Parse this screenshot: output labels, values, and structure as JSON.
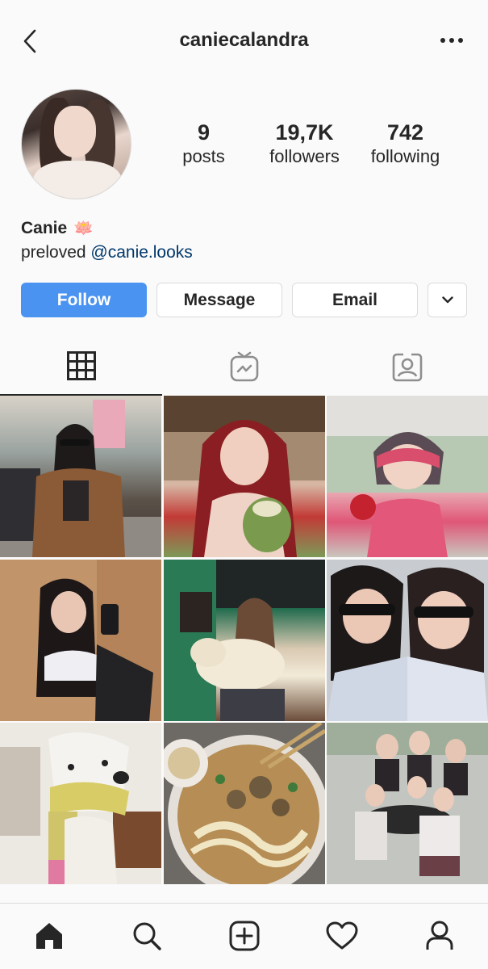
{
  "header": {
    "username": "caniecalandra",
    "back_icon": "chevron-left-icon",
    "more_icon": "more-horizontal-icon"
  },
  "profile": {
    "stats": [
      {
        "value": "9",
        "label": "posts"
      },
      {
        "value": "19,7K",
        "label": "followers"
      },
      {
        "value": "742",
        "label": "following"
      }
    ],
    "name": "Canie",
    "name_emoji": "🪷",
    "bio_text": "preloved",
    "bio_mention": "@canie.looks"
  },
  "actions": {
    "follow": "Follow",
    "message": "Message",
    "email": "Email",
    "dropdown_icon": "chevron-down-icon"
  },
  "tabs": [
    {
      "icon": "grid-icon",
      "active": true
    },
    {
      "icon": "igtv-icon",
      "active": false
    },
    {
      "icon": "tagged-icon",
      "active": false
    }
  ],
  "posts_count": 9,
  "bottom_nav": [
    "home-icon",
    "search-icon",
    "new-post-icon",
    "activity-icon",
    "profile-icon"
  ],
  "colors": {
    "accent": "#4a93f0",
    "mention": "#00376b",
    "text": "#262626",
    "border": "#dbdbdb"
  }
}
